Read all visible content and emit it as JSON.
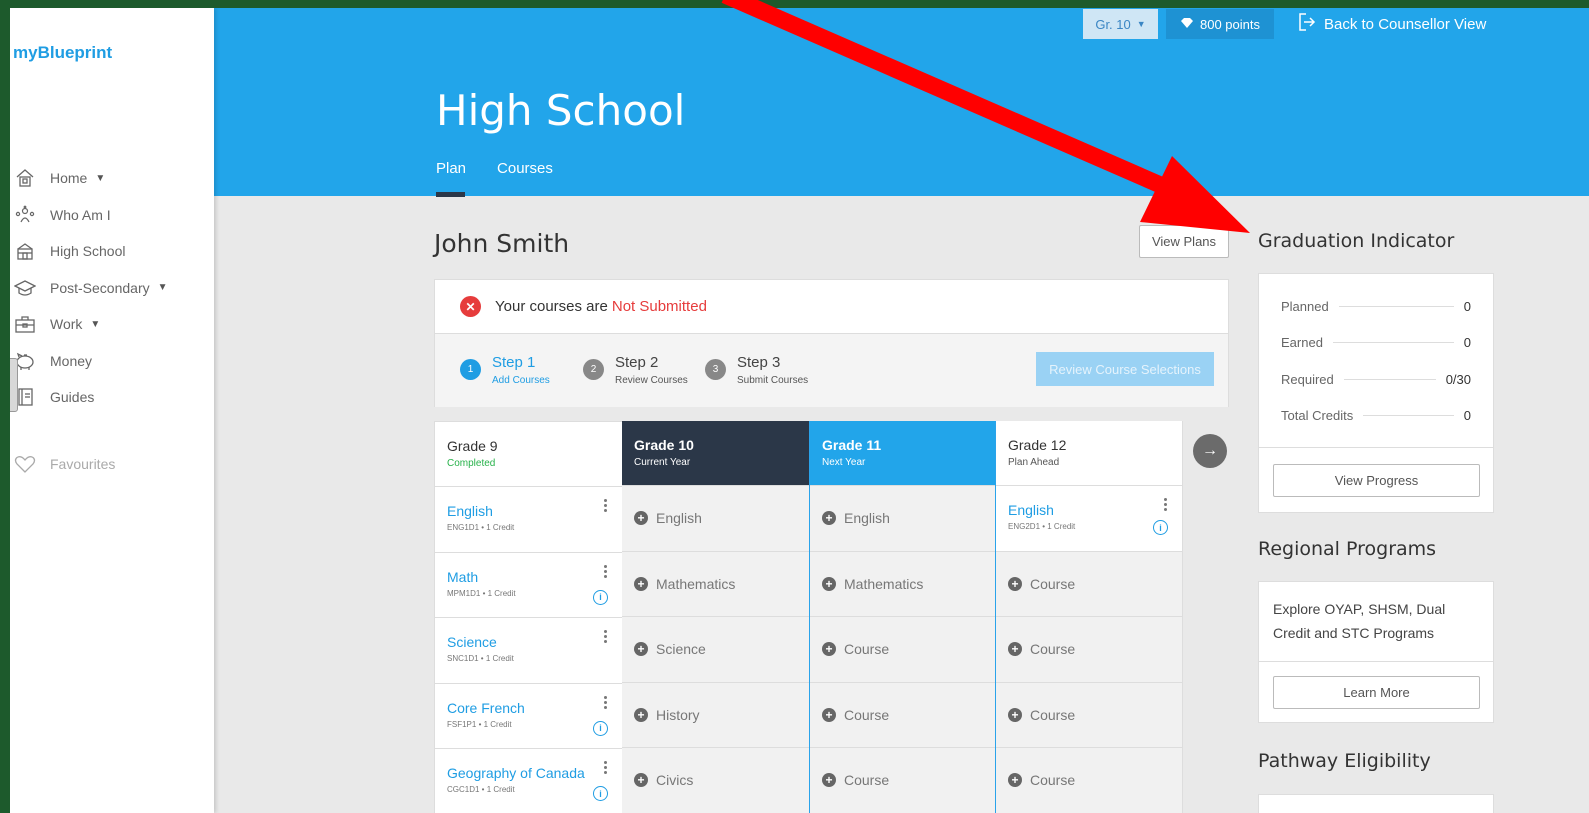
{
  "app": {
    "logo": "myBlueprint"
  },
  "sidebar": {
    "items": [
      {
        "label": "Home",
        "icon": "home-icon",
        "caret": true
      },
      {
        "label": "Who Am I",
        "icon": "people-icon",
        "caret": false
      },
      {
        "label": "High School",
        "icon": "school-icon",
        "caret": false
      },
      {
        "label": "Post-Secondary",
        "icon": "graduation-cap-icon",
        "caret": true
      },
      {
        "label": "Work",
        "icon": "briefcase-icon",
        "caret": true
      },
      {
        "label": "Money",
        "icon": "piggy-bank-icon",
        "caret": false
      },
      {
        "label": "Guides",
        "icon": "book-icon",
        "caret": false
      }
    ],
    "favourites": "Favourites"
  },
  "header": {
    "grade_select": "Gr. 10",
    "points": "800 points",
    "back_link": "Back to Counsellor View",
    "title": "High School",
    "tabs": [
      "Plan",
      "Courses"
    ],
    "active_tab": "Plan"
  },
  "student": {
    "name": "John Smith",
    "view_plans": "View Plans"
  },
  "status": {
    "prefix": "Your courses are",
    "state": "Not Submitted",
    "steps": [
      {
        "num": "1",
        "title": "Step 1",
        "sub": "Add Courses"
      },
      {
        "num": "2",
        "title": "Step 2",
        "sub": "Review Courses"
      },
      {
        "num": "3",
        "title": "Step 3",
        "sub": "Submit Courses"
      }
    ],
    "review_button": "Review Course Selections"
  },
  "grades": [
    {
      "title": "Grade 9",
      "sub": "Completed",
      "courses": [
        {
          "name": "English",
          "code": "ENG1D1 • 1 Credit",
          "info": false
        },
        {
          "name": "Math",
          "code": "MPM1D1 • 1 Credit",
          "info": true
        },
        {
          "name": "Science",
          "code": "SNC1D1 • 1 Credit",
          "info": false
        },
        {
          "name": "Core French",
          "code": "FSF1P1 • 1 Credit",
          "info": true
        },
        {
          "name": "Geography of Canada",
          "code": "CGC1D1 • 1 Credit",
          "info": true
        }
      ]
    },
    {
      "title": "Grade 10",
      "sub": "Current Year",
      "slots": [
        "English",
        "Mathematics",
        "Science",
        "History",
        "Civics"
      ]
    },
    {
      "title": "Grade 11",
      "sub": "Next Year",
      "slots": [
        "English",
        "Mathematics",
        "Course",
        "Course",
        "Course"
      ]
    },
    {
      "title": "Grade 12",
      "sub": "Plan Ahead",
      "first_course": {
        "name": "English",
        "code": "ENG2D1 • 1 Credit",
        "info": true
      },
      "slots": [
        "Course",
        "Course",
        "Course",
        "Course"
      ]
    }
  ],
  "graduation": {
    "title": "Graduation Indicator",
    "rows": [
      {
        "label": "Planned",
        "value": "0"
      },
      {
        "label": "Earned",
        "value": "0"
      },
      {
        "label": "Required",
        "value": "0/30"
      },
      {
        "label": "Total Credits",
        "value": "0"
      }
    ],
    "button": "View Progress"
  },
  "regional": {
    "title": "Regional Programs",
    "text": "Explore OYAP, SHSM, Dual Credit and STC Programs",
    "button": "Learn More"
  },
  "pathway": {
    "title": "Pathway Eligibility"
  },
  "colors": {
    "brand_blue": "#22a5ea",
    "dark_navy": "#2b3748",
    "error_red": "#e63c3c",
    "success_green": "#28b24b",
    "annotation_red": "#ff0000",
    "background_green": "#1d5a2c"
  }
}
